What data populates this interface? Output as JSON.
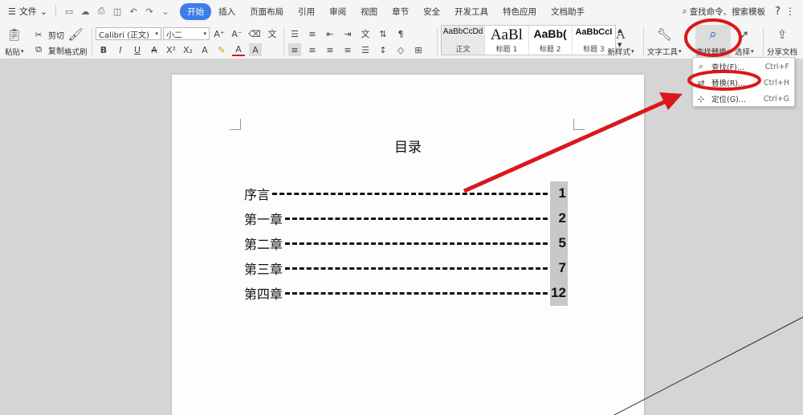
{
  "menubar": {
    "file_label": "文件",
    "tabs": [
      "开始",
      "插入",
      "页面布局",
      "引用",
      "审阅",
      "视图",
      "章节",
      "安全",
      "开发工具",
      "特色应用",
      "文档助手"
    ],
    "search_label": "查找命令、搜索模板",
    "help_label": "?"
  },
  "ribbon": {
    "paste_label": "粘贴",
    "cut_label": "剪切",
    "copy_label": "复制",
    "format_painter_label": "格式刷",
    "font_name": "Calibri (正文)",
    "font_size": "小二",
    "styles": [
      {
        "sample": "AaBbCcDd",
        "name": "正文"
      },
      {
        "sample": "AaBl",
        "name": "标题 1"
      },
      {
        "sample": "AaBb(",
        "name": "标题 2"
      },
      {
        "sample": "AaBbCcI",
        "name": "标题 3"
      }
    ],
    "new_style_label": "新样式",
    "text_tools_label": "文字工具",
    "find_replace_label": "查找替换",
    "select_label": "选择",
    "share_label": "分享文档"
  },
  "dropdown": {
    "items": [
      {
        "label": "查找(F)...",
        "shortcut": "Ctrl+F",
        "icon": "search-icon"
      },
      {
        "label": "替换(R)...",
        "shortcut": "Ctrl+H",
        "icon": "replace-icon"
      },
      {
        "label": "定位(G)...",
        "shortcut": "Ctrl+G",
        "icon": "goto-icon"
      }
    ]
  },
  "document": {
    "title": "目录",
    "toc": [
      {
        "label": "序言",
        "page": "1"
      },
      {
        "label": "第一章",
        "page": "2"
      },
      {
        "label": "第二章",
        "page": "5"
      },
      {
        "label": "第三章",
        "page": "7"
      },
      {
        "label": "第四章",
        "page": "12"
      }
    ]
  },
  "colors": {
    "accent": "#3d7de8",
    "annotation": "#d9181b"
  }
}
